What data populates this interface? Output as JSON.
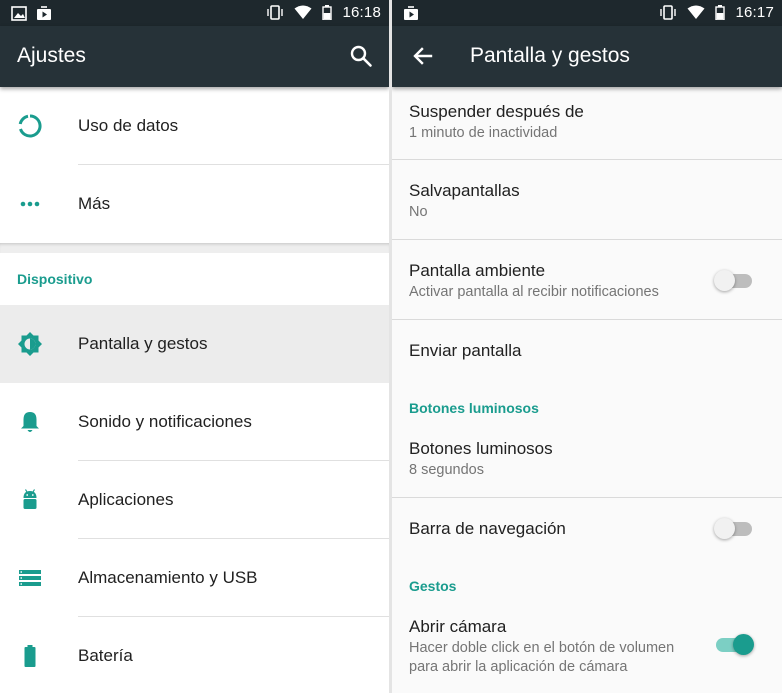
{
  "colors": {
    "accent": "#1a9c8e",
    "toolbar": "#263238",
    "statusbar": "#1e282d"
  },
  "left": {
    "status": {
      "time": "16:18"
    },
    "title": "Ajustes",
    "search_icon": "search-icon",
    "items_top": [
      {
        "label": "Uso de datos",
        "icon": "data-usage-icon"
      },
      {
        "label": "Más",
        "icon": "more-horiz-icon"
      }
    ],
    "section": "Dispositivo",
    "items": [
      {
        "label": "Pantalla y gestos",
        "icon": "brightness-icon",
        "selected": true
      },
      {
        "label": "Sonido y notificaciones",
        "icon": "bell-icon"
      },
      {
        "label": "Aplicaciones",
        "icon": "android-icon"
      },
      {
        "label": "Almacenamiento y USB",
        "icon": "storage-icon"
      },
      {
        "label": "Batería",
        "icon": "battery-icon"
      }
    ]
  },
  "right": {
    "status": {
      "time": "16:17"
    },
    "title": "Pantalla y gestos",
    "back_icon": "back-arrow-icon",
    "prefs": [
      {
        "title": "Suspender después de",
        "summary": "1 minuto de inactividad"
      },
      {
        "title": "Salvapantallas",
        "summary": "No"
      },
      {
        "title": "Pantalla ambiente",
        "summary": "Activar pantalla al recibir notificaciones",
        "switch_on": false
      },
      {
        "title": "Enviar pantalla"
      }
    ],
    "category_buttons": "Botones luminosos",
    "buttons_pref": {
      "title": "Botones luminosos",
      "summary": "8 segundos"
    },
    "nav_bar": {
      "title": "Barra de navegación",
      "switch_on": false
    },
    "category_gestures": "Gestos",
    "camera": {
      "title": "Abrir cámara",
      "summary_line1": "Hacer doble click en el botón de volumen",
      "summary_line2": "para abrir la aplicación de cámara",
      "switch_on": true
    }
  }
}
